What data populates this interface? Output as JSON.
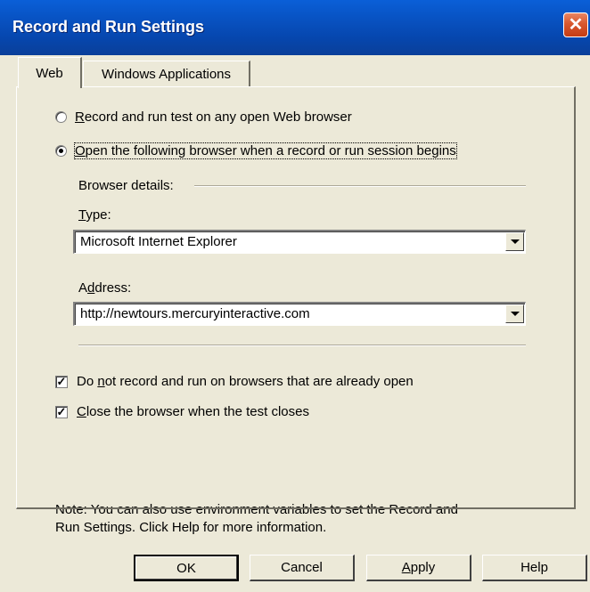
{
  "window": {
    "title": "Record and Run Settings",
    "close_glyph": "✕"
  },
  "tabs": [
    {
      "label": "Web"
    },
    {
      "label": "Windows Applications"
    }
  ],
  "web": {
    "radio_any_browser": {
      "accesskey": "R",
      "label_rest": "ecord and run test on any open Web browser",
      "selected": false
    },
    "radio_open_browser": {
      "accesskey": "O",
      "label_rest": "pen the following browser when a record or run session begins",
      "selected": true
    },
    "browser_details_label": "Browser details:",
    "type": {
      "accesskey": "T",
      "label_rest": "ype:",
      "value": "Microsoft Internet Explorer"
    },
    "address": {
      "label_pre": "A",
      "accesskey": "d",
      "label_rest": "dress:",
      "value": "http://newtours.mercuryinteractive.com"
    },
    "check_do_not_record": {
      "label_pre": "Do ",
      "accesskey": "n",
      "label_rest": "ot record and run on browsers that are already open",
      "checked": true
    },
    "check_close_browser": {
      "accesskey": "C",
      "label_rest": "lose the browser when the test closes",
      "checked": true
    },
    "note_line1": "Note: You can also use environment variables to set the Record and",
    "note_line2": "Run Settings.  Click Help for more information."
  },
  "buttons": {
    "ok": "OK",
    "cancel": "Cancel",
    "apply_accesskey": "A",
    "apply_rest": "pply",
    "help": "Help"
  },
  "colors": {
    "titlebar": "#0a5fd8",
    "dialog_bg": "#ece9d8",
    "close_button": "#d8582e"
  }
}
